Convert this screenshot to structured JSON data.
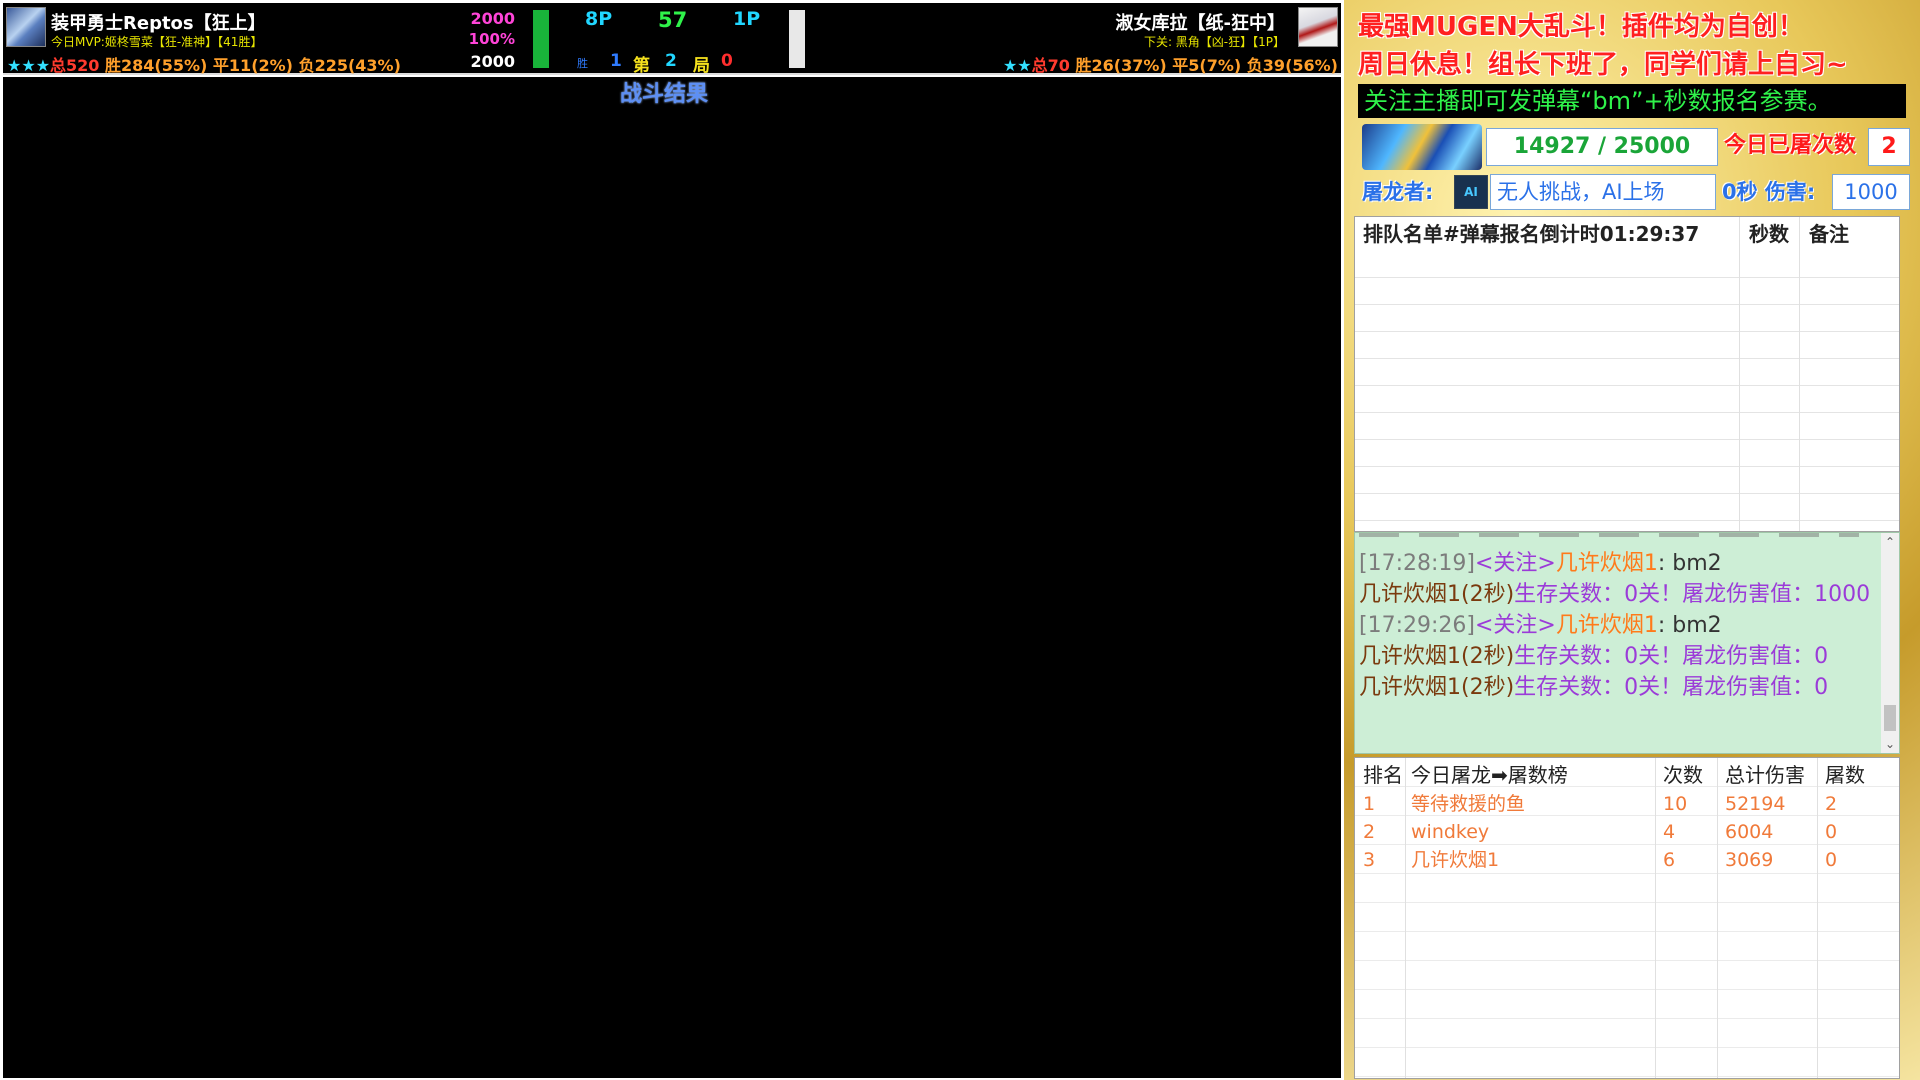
{
  "hud": {
    "left": {
      "name": "装甲勇士Reptos【狂上】",
      "mvp": "今日MVP:姬柊雪菜【狂-准神】【41胜】",
      "stars": "★★★",
      "total": "总520",
      "win": "胜284(55%)",
      "draw": "平11(2%)",
      "lose": "负225(43%)",
      "power_top": "2000",
      "power_pct": "100%",
      "power_bottom": "2000"
    },
    "center": {
      "p8": "8P",
      "timer": "57",
      "p1": "1P",
      "win_small": "胜",
      "score_left": "1",
      "round_label_a": "第",
      "round_num": "2",
      "round_label_b": "局",
      "score_right": "0"
    },
    "right": {
      "name": "淑女库拉【纸-狂中】",
      "next": "下关: 黑角【凶-狂】【1P】",
      "stars": "★★",
      "total": "总70",
      "win": "胜26(37%)",
      "draw": "平5(7%)",
      "lose": "负39(56%)"
    },
    "result_title": "战斗结果"
  },
  "panel": {
    "banner_line1": "最强MUGEN大乱斗！插件均为自创！",
    "banner_line2": "周日休息！组长下班了，同学们请上自习~",
    "notice": "关注主播即可发弹幕“bm”+秒数报名参赛。",
    "hp": "14927 / 25000",
    "today_label": "今日已屠次数",
    "today_value": "2",
    "slayer_label": "屠龙者:",
    "ai_icon_text": "AI",
    "challenger": "无人挑战，AI上场",
    "damage_label": "0秒 伤害:",
    "damage_value": "1000",
    "queue": {
      "header_name": "排队名单#弹幕报名倒计时01:29:37",
      "header_seconds": "秒数",
      "header_note": "备注"
    },
    "chat": [
      {
        "time": "[17:28:19]",
        "follow": "<关注>",
        "user": "几许炊烟1",
        "sep": ":",
        "msg": "bm2"
      },
      {
        "name": "几许炊烟1(2秒)",
        "stat": "生存关数：0关！屠龙伤害值：1000"
      },
      {
        "time": "[17:29:26]",
        "follow": "<关注>",
        "user": "几许炊烟1",
        "sep": ":",
        "msg": "bm2"
      },
      {
        "name": "几许炊烟1(2秒)",
        "stat": "生存关数：0关！屠龙伤害值：0"
      },
      {
        "name": "几许炊烟1(2秒)",
        "stat": "生存关数：0关！屠龙伤害值：0"
      }
    ],
    "board": {
      "headers": [
        "排名",
        "今日屠龙➡屠数榜",
        "次数",
        "总计伤害",
        "屠数"
      ],
      "rows": [
        [
          "1",
          "等待救援的鱼",
          "10",
          "52194",
          "2"
        ],
        [
          "2",
          "windkey",
          "4",
          "6004",
          "0"
        ],
        [
          "3",
          "几许炊烟1",
          "6",
          "3069",
          "0"
        ]
      ]
    }
  }
}
